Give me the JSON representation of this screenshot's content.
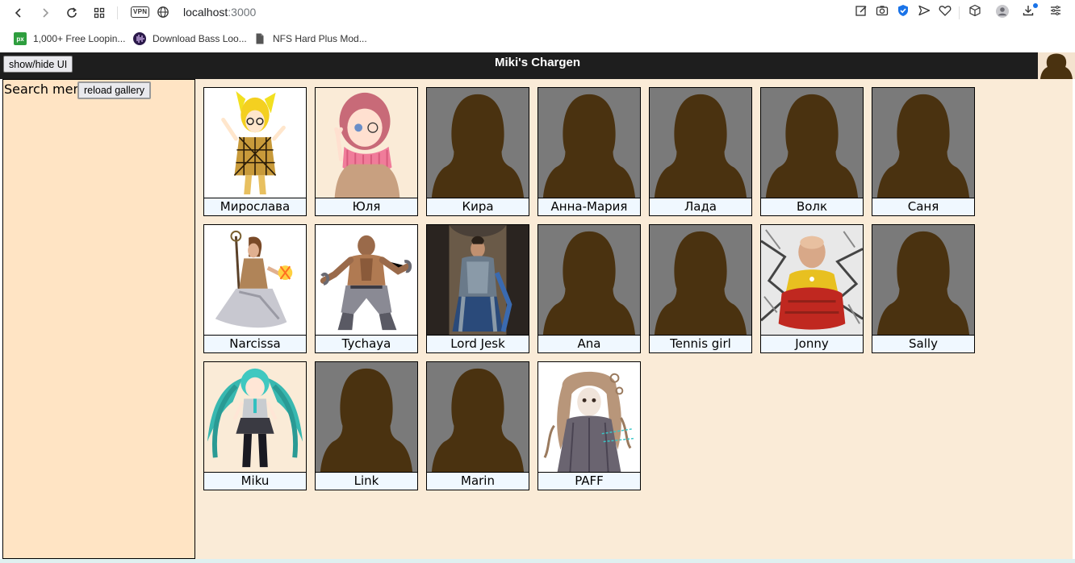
{
  "browser": {
    "url_host": "localhost",
    "url_port": ":3000",
    "vpn_label": "VPN",
    "bookmarks": [
      {
        "label": "1,000+ Free Loopin...",
        "icon": "px-icon",
        "icon_text": "px"
      },
      {
        "label": "Download Bass Loo...",
        "icon": "waveform-icon"
      },
      {
        "label": "NFS Hard Plus Mod...",
        "icon": "document-icon"
      }
    ]
  },
  "header": {
    "toggle_label": "show/hide UI",
    "title": "Miki's Chargen"
  },
  "sidebar": {
    "search_label": "Search menu",
    "reload_label": "reload gallery"
  },
  "gallery": {
    "characters": [
      {
        "name": "Мирослава",
        "image": "portrait-blonde-glasses"
      },
      {
        "name": "Юля",
        "image": "portrait-pink-hair-scarf"
      },
      {
        "name": "Кира",
        "image": "placeholder-silhouette"
      },
      {
        "name": "Анна-Мария",
        "image": "placeholder-silhouette"
      },
      {
        "name": "Лада",
        "image": "placeholder-silhouette"
      },
      {
        "name": "Волк",
        "image": "placeholder-silhouette"
      },
      {
        "name": "Саня",
        "image": "placeholder-silhouette"
      },
      {
        "name": "Narcissa",
        "image": "portrait-sorceress-staff"
      },
      {
        "name": "Tychaya",
        "image": "portrait-monk-fighter"
      },
      {
        "name": "Lord Jesk",
        "image": "portrait-armored-knight"
      },
      {
        "name": "Ana",
        "image": "placeholder-silhouette"
      },
      {
        "name": "Tennis girl",
        "image": "placeholder-silhouette"
      },
      {
        "name": "Jonny",
        "image": "portrait-bald-hero"
      },
      {
        "name": "Sally",
        "image": "placeholder-silhouette"
      },
      {
        "name": "Miku",
        "image": "portrait-twintails-teal"
      },
      {
        "name": "Link",
        "image": "placeholder-silhouette"
      },
      {
        "name": "Marin",
        "image": "placeholder-silhouette"
      },
      {
        "name": "PAFF",
        "image": "portrait-sketch-girl"
      }
    ]
  },
  "colors": {
    "header_bg": "#1e1e1e",
    "sidebar_bg": "#ffe4c4",
    "gallery_bg": "#faebd7",
    "name_bg": "#f0f8ff",
    "placeholder_bg": "#7a7a7a",
    "silhouette": "#4a3210"
  }
}
